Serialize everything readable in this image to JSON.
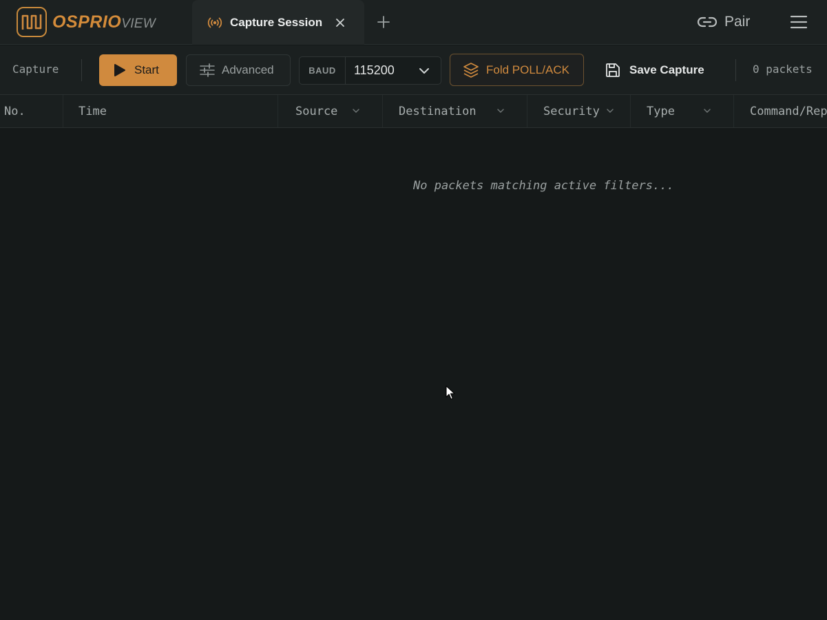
{
  "app": {
    "brand": "OSPRIO",
    "brand_sub": "VIEW",
    "accent_color": "#d08a3e"
  },
  "tabs": [
    {
      "label": "Capture Session",
      "icon": "broadcast-icon",
      "active": true
    }
  ],
  "header_actions": {
    "pair_label": "Pair",
    "pair_icon": "link-icon",
    "menu_icon": "hamburger-menu-icon"
  },
  "toolbar": {
    "section_label": "Capture",
    "start_label": "Start",
    "advanced_label": "Advanced",
    "baud_tag": "BAUD",
    "baud_value": "115200",
    "fold_label": "Fold POLL/ACK",
    "save_label": "Save Capture",
    "packet_count": "0 packets"
  },
  "table": {
    "columns": [
      {
        "label": "No.",
        "filterable": false
      },
      {
        "label": "Time",
        "filterable": false
      },
      {
        "label": "Source",
        "filterable": true
      },
      {
        "label": "Destination",
        "filterable": true
      },
      {
        "label": "Security",
        "filterable": true
      },
      {
        "label": "Type",
        "filterable": true
      },
      {
        "label": "Command/Rep",
        "filterable": false
      }
    ],
    "rows": [],
    "empty_message": "No packets matching active filters..."
  }
}
